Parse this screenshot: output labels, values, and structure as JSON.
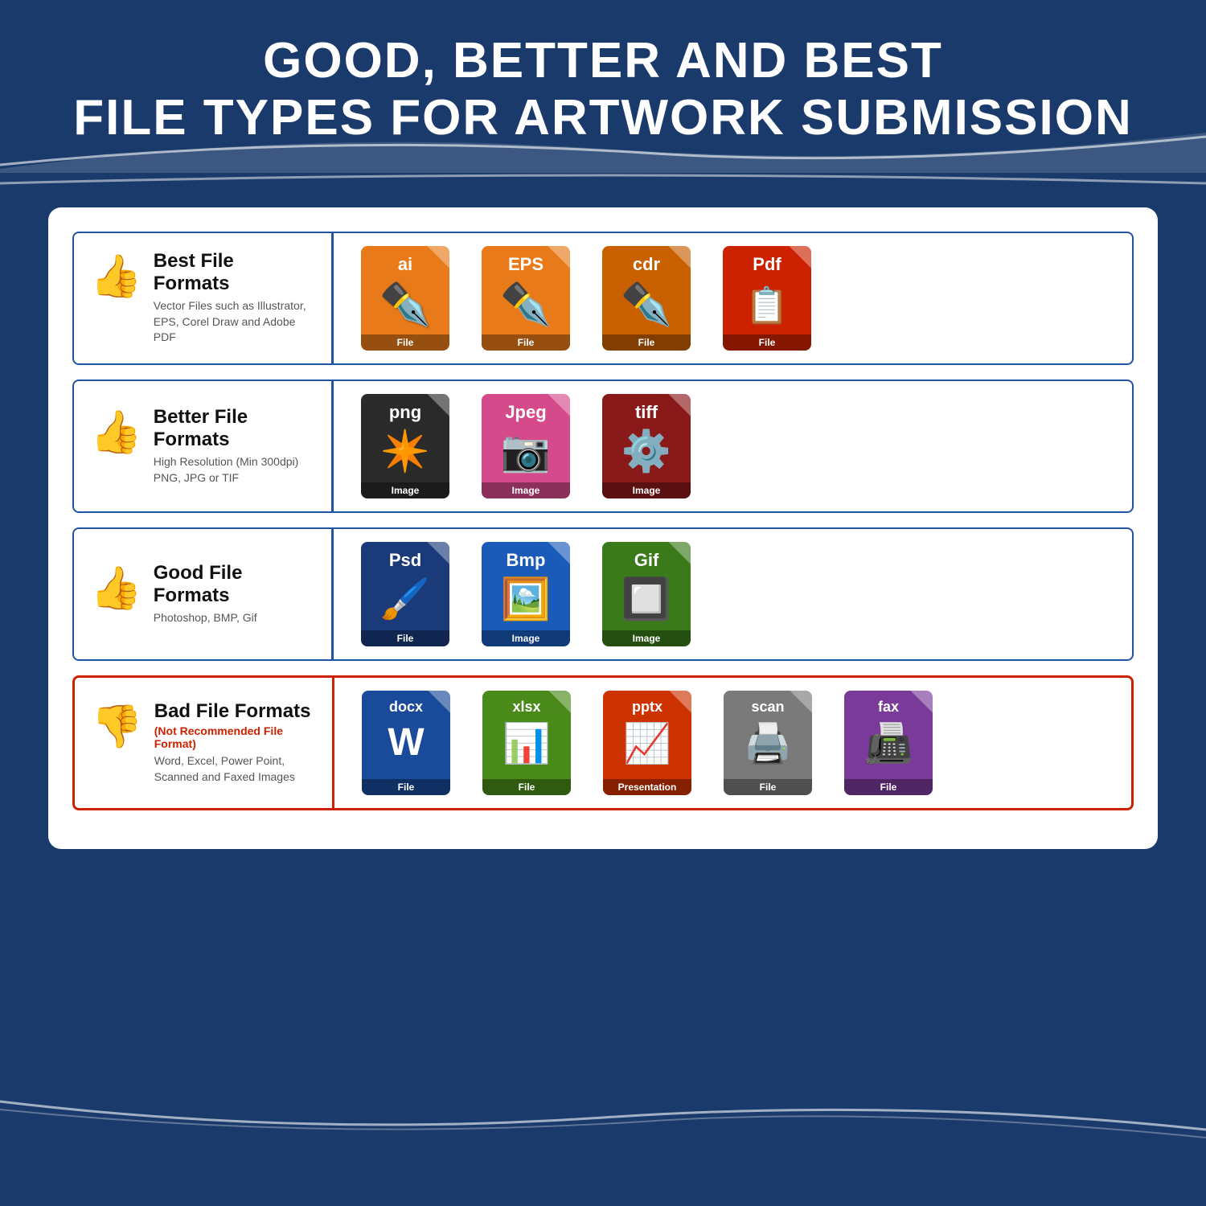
{
  "header": {
    "line1": "GOOD, BETTER AND BEST",
    "line2": "FILE TYPES FOR ARTWORK SUBMISSION"
  },
  "rows": [
    {
      "id": "best",
      "thumb": "👍",
      "heading": "Best File Formats",
      "sub": "Vector Files such as Illustrator,\nEPS, Corel Draw and Adobe PDF",
      "sub_red": null,
      "bad": false,
      "files": [
        {
          "ext": "ai",
          "color": "orange",
          "icon": "✏️",
          "label": "File"
        },
        {
          "ext": "EPS",
          "color": "orange",
          "icon": "✏️",
          "label": "File"
        },
        {
          "ext": "cdr",
          "color": "orange-mid",
          "icon": "✏️",
          "label": "File"
        },
        {
          "ext": "Pdf",
          "color": "red-file",
          "icon": "📄",
          "label": "File"
        }
      ]
    },
    {
      "id": "better",
      "thumb": "👍",
      "heading": "Better File Formats",
      "sub": "High Resolution (Min 300dpi)\nPNG, JPG or TIF",
      "sub_red": null,
      "bad": false,
      "files": [
        {
          "ext": "png",
          "color": "dark-gray",
          "icon": "⭐",
          "label": "Image"
        },
        {
          "ext": "Jpeg",
          "color": "pink",
          "icon": "📷",
          "label": "Image"
        },
        {
          "ext": "tiff",
          "color": "dark-red",
          "icon": "⚙️",
          "label": "Image"
        }
      ]
    },
    {
      "id": "good",
      "thumb": "👍",
      "heading": "Good File Formats",
      "sub": "Photoshop, BMP, Gif",
      "sub_red": null,
      "bad": false,
      "files": [
        {
          "ext": "Psd",
          "color": "navy-blue",
          "icon": "🖌️",
          "label": "File"
        },
        {
          "ext": "Bmp",
          "color": "mid-blue",
          "icon": "🖼️",
          "label": "Image"
        },
        {
          "ext": "Gif",
          "color": "green",
          "icon": "🔳",
          "label": "Image"
        }
      ]
    },
    {
      "id": "bad",
      "thumb": "👎",
      "heading": "Bad File Formats",
      "sub_red": "(Not Recommended File Format)",
      "sub": "Word, Excel, Power Point,\nScanned and Faxed Images",
      "bad": true,
      "files": [
        {
          "ext": "docx",
          "color": "word-blue",
          "icon": "W",
          "label": "File"
        },
        {
          "ext": "xlsx",
          "color": "excel-green",
          "icon": "X",
          "label": "File"
        },
        {
          "ext": "pptx",
          "color": "ppt-red",
          "icon": "📊",
          "label": "Presentation"
        },
        {
          "ext": "scan",
          "color": "gray-scan",
          "icon": "🖨️",
          "label": "File"
        },
        {
          "ext": "fax",
          "color": "purple",
          "icon": "📠",
          "label": "File"
        }
      ]
    }
  ]
}
